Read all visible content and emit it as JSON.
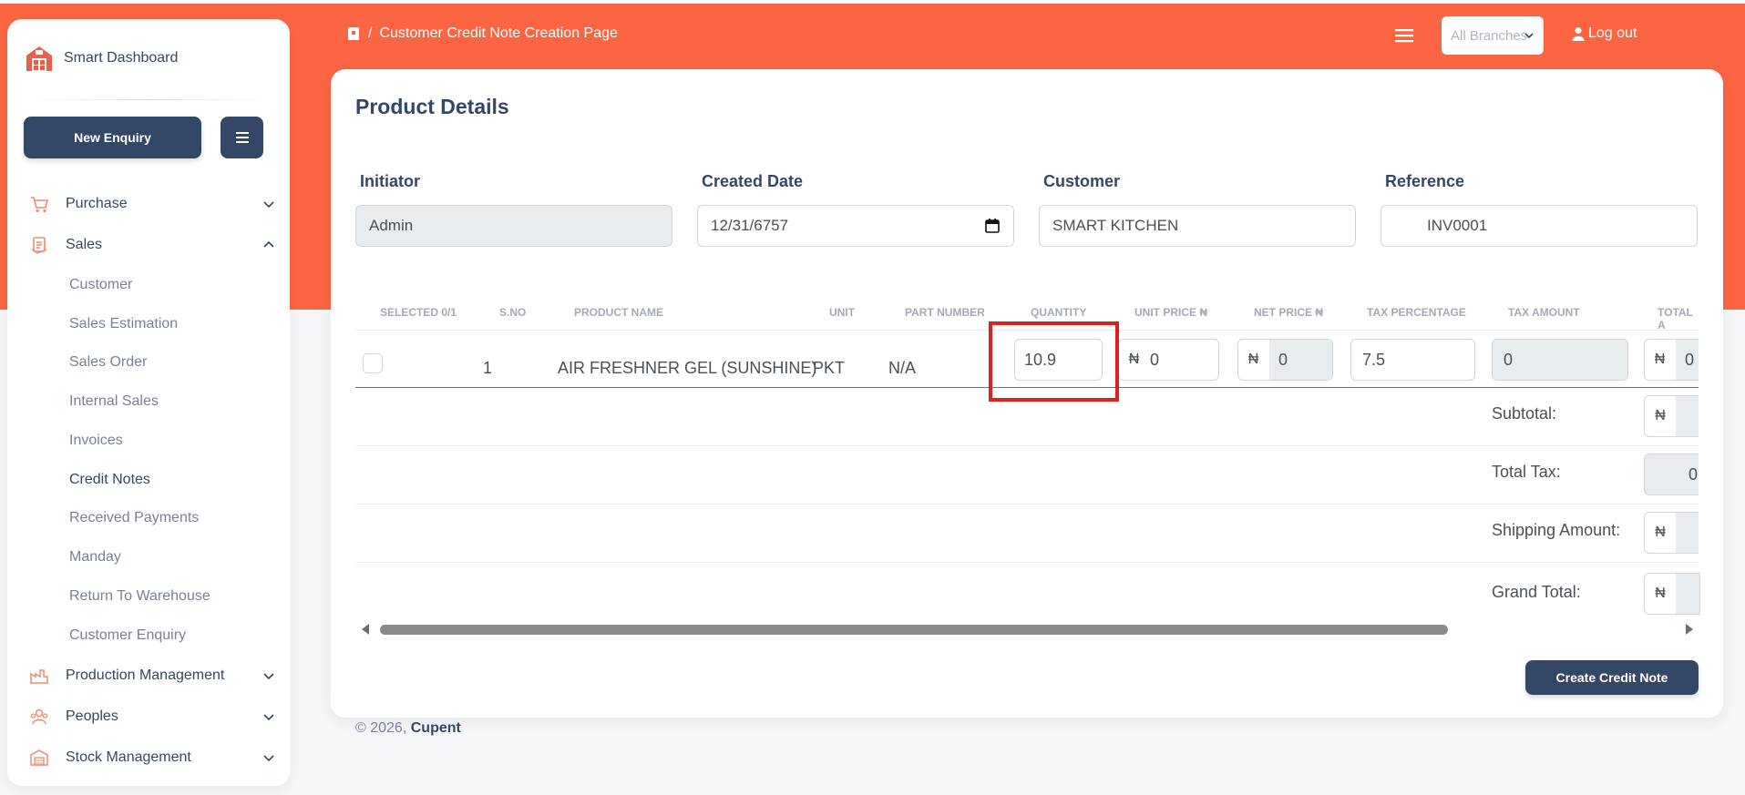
{
  "sidebar": {
    "brand": "Smart Dashboard",
    "new_enquiry_label": "New Enquiry",
    "items": [
      {
        "label": "Purchase",
        "icon": "cart-icon"
      },
      {
        "label": "Sales",
        "icon": "sales-icon"
      },
      {
        "label": "Production Management",
        "icon": "production-icon"
      },
      {
        "label": "Peoples",
        "icon": "people-icon"
      },
      {
        "label": "Stock Management",
        "icon": "warehouse-icon"
      }
    ],
    "sales_subitems": [
      "Customer",
      "Sales Estimation",
      "Sales Order",
      "Internal Sales",
      "Invoices",
      "Credit Notes",
      "Received Payments",
      "Manday",
      "Return To Warehouse",
      "Customer Enquiry"
    ],
    "active_subitem": "Credit Notes"
  },
  "header": {
    "breadcrumb_separator": "/",
    "page_name": "Customer Credit Note Creation Page",
    "branch_select": "All Branches",
    "logout": "Log out"
  },
  "form": {
    "title": "Product Details",
    "initiator_label": "Initiator",
    "initiator_value": "Admin",
    "created_date_label": "Created Date",
    "created_date_value": "12/31/6757",
    "customer_label": "Customer",
    "customer_value": "SMART KITCHEN",
    "reference_label": "Reference",
    "reference_value": "INV0001"
  },
  "table": {
    "headers": [
      "SELECTED 0/1",
      "S.NO",
      "PRODUCT NAME",
      "UNIT",
      "PART NUMBER",
      "QUANTITY",
      "UNIT PRICE ₦",
      "NET PRICE ₦",
      "TAX PERCENTAGE",
      "TAX AMOUNT",
      "TOTAL A"
    ],
    "row": {
      "sno": "1",
      "product_name": "AIR FRESHNER GEL (SUNSHINE)",
      "unit": "PKT",
      "part_number": "N/A",
      "quantity": "10.9",
      "unit_price": "0",
      "net_price": "0",
      "tax_percentage": "7.5",
      "tax_amount": "0",
      "total": "0"
    },
    "currency_symbol": "₦",
    "summary": {
      "subtotal_label": "Subtotal:",
      "total_tax_label": "Total Tax:",
      "total_tax_value": "0",
      "shipping_label": "Shipping Amount:",
      "grand_total_label": "Grand Total:"
    }
  },
  "actions": {
    "create_label": "Create Credit Note"
  },
  "footer": {
    "copyright": "© 2026,",
    "company": "Cupent"
  },
  "colors": {
    "accent": "#fc6542",
    "primary": "#344767",
    "highlight": "#e02020"
  }
}
